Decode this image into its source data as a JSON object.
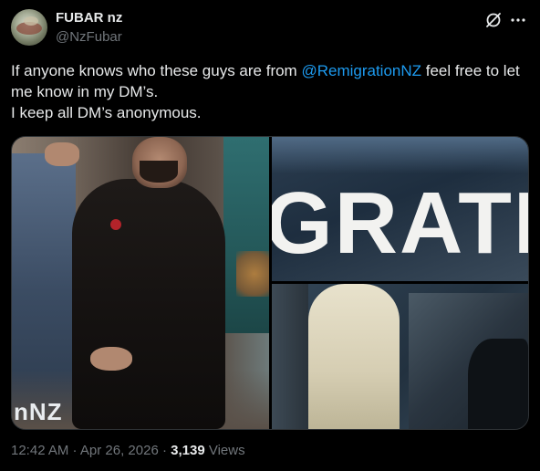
{
  "author": {
    "display_name": "FUBAR nz",
    "handle": "@NzFubar"
  },
  "tweet": {
    "text_part1": "If anyone knows who these guys are from ",
    "mention": "@RemigrationNZ",
    "text_part2": " feel free to let me know in my DM’s.",
    "text_line2": "I keep all DM’s anonymous."
  },
  "media": {
    "photos": [
      {
        "description": "man in dark suit beside poster",
        "poster_text": "nNZ"
      },
      {
        "description": "close-up of sign lettering",
        "sign_text": "GRATI"
      },
      {
        "description": "person in light jacket in front of poster"
      }
    ]
  },
  "meta": {
    "time": "12:42 AM",
    "separator1": " · ",
    "date": "Apr 26, 2026",
    "separator2": " · ",
    "views_count": "3,139",
    "views_label": " Views"
  },
  "icons": {
    "grok": "grok-icon",
    "more": "more-icon"
  },
  "colors": {
    "background": "#000000",
    "text_primary": "#e7e9ea",
    "text_secondary": "#71767b",
    "link": "#1d9bf0"
  }
}
